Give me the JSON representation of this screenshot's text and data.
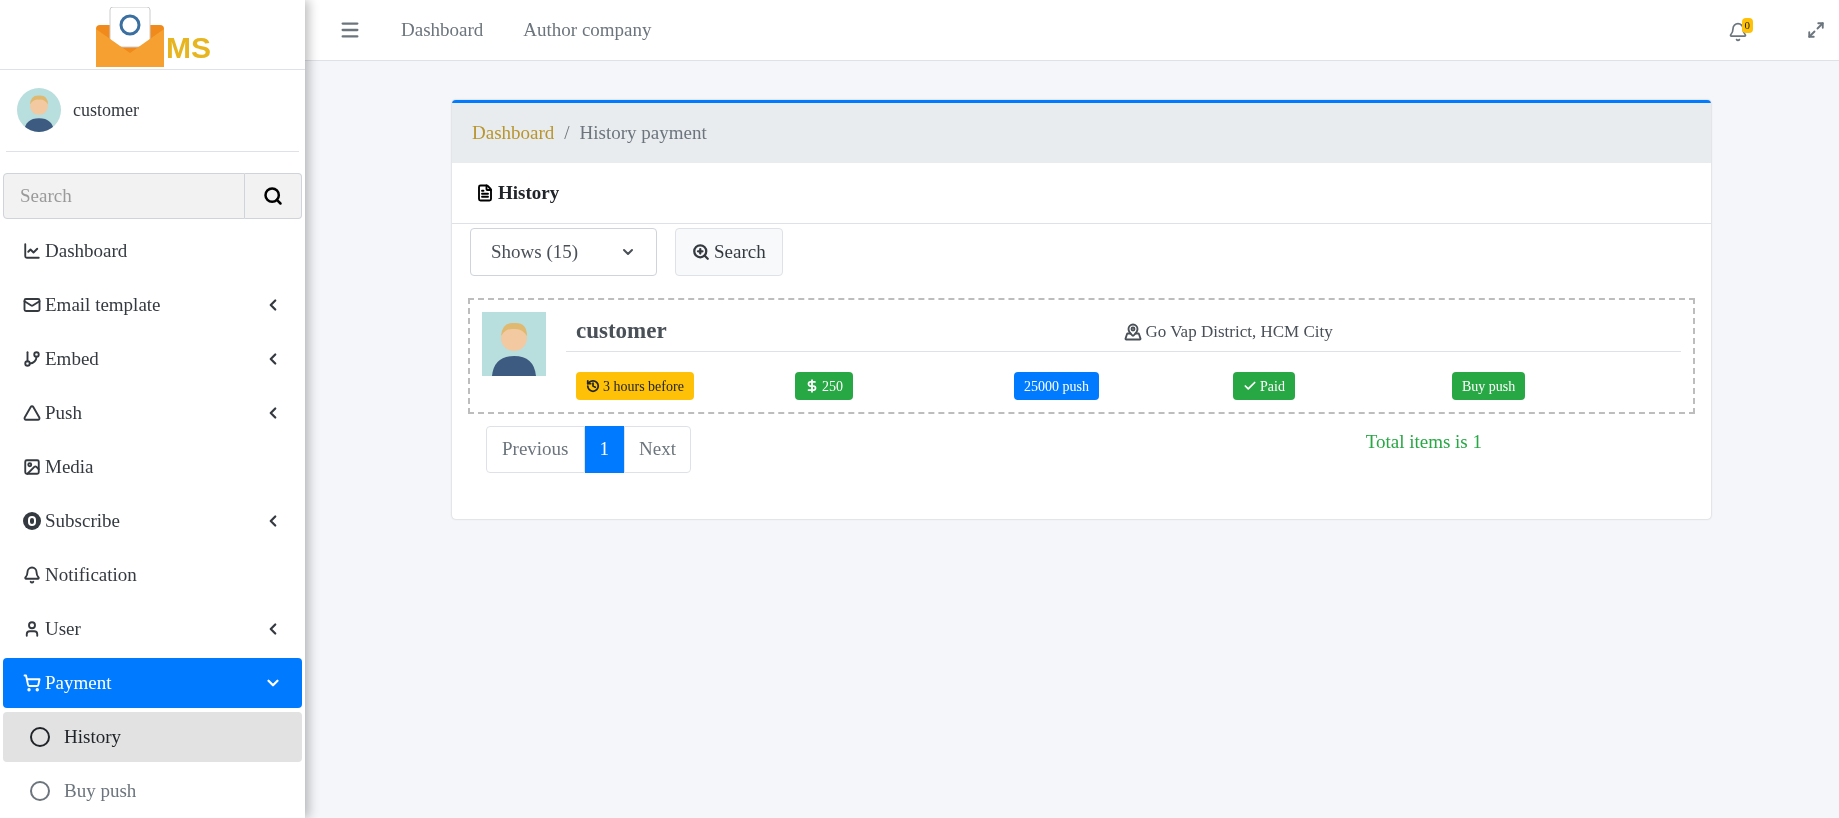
{
  "logo": {
    "text": "MS"
  },
  "user": {
    "name": "customer"
  },
  "sidebar_search": {
    "placeholder": "Search"
  },
  "sidebar": {
    "items": [
      {
        "label": "Dashboard",
        "selected": false
      },
      {
        "label": "Email template",
        "expanded": false,
        "selected": false
      },
      {
        "label": "Embed",
        "expanded": false,
        "selected": false
      },
      {
        "label": "Push",
        "expanded": false,
        "selected": false
      },
      {
        "label": "Media",
        "selected": false
      },
      {
        "label": "Subscribe",
        "expanded": false,
        "selected": false
      },
      {
        "label": "Notification",
        "selected": false
      },
      {
        "label": "User",
        "expanded": false,
        "selected": false
      },
      {
        "label": "Payment",
        "expanded": true,
        "selected": true,
        "children": [
          {
            "label": "History",
            "selected": true
          },
          {
            "label": "Buy push",
            "selected": false
          }
        ]
      }
    ]
  },
  "topbar": {
    "links": [
      "Dashboard",
      "Author company"
    ],
    "notification_count": "0"
  },
  "breadcrumb": [
    {
      "label": "Dashboard",
      "kind": "link"
    },
    {
      "label": "/",
      "kind": "separator"
    },
    {
      "label": "History payment",
      "kind": "current"
    }
  ],
  "card": {
    "title": "History",
    "page_size_select": {
      "value": "Shows (15)"
    },
    "search_button": "Search",
    "records": [
      {
        "name": "customer",
        "location": "Go Vap District, HCM City",
        "badges": [
          {
            "kind": "time",
            "text": "3 hours before",
            "color": "#ffc107"
          },
          {
            "kind": "amount",
            "text": "250",
            "color": "#28a745"
          },
          {
            "kind": "quantity",
            "text": "25000 push",
            "color": "#007bff"
          },
          {
            "kind": "status",
            "text": "Paid",
            "color": "#28a745"
          },
          {
            "kind": "type",
            "text": "Buy push",
            "color": "#28a745"
          }
        ]
      }
    ],
    "pagination": {
      "previous": "Previous",
      "pages": [
        {
          "label": "1",
          "selected": true
        }
      ],
      "next": "Next"
    },
    "total": "Total items is 1"
  }
}
